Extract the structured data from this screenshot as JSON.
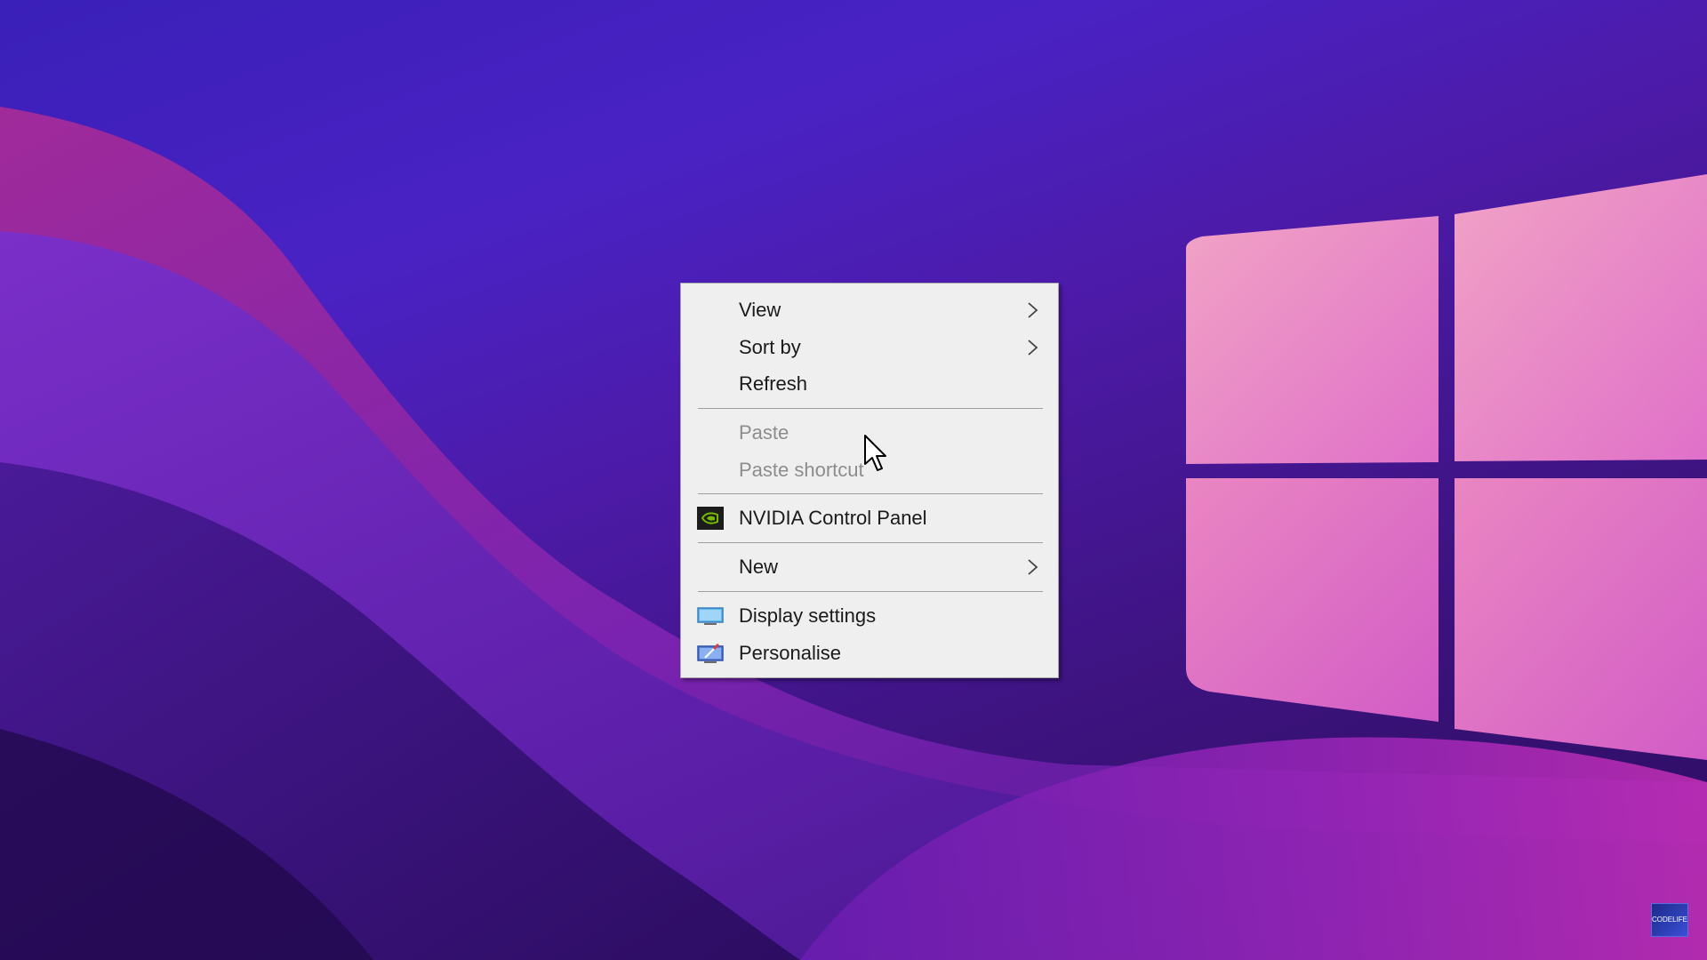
{
  "desktop": {
    "wallpaper": "windows-logo-wave-wallpaper"
  },
  "context_menu": {
    "items": [
      {
        "label": "View",
        "has_submenu": true,
        "disabled": false
      },
      {
        "label": "Sort by",
        "has_submenu": true,
        "disabled": false
      },
      {
        "label": "Refresh",
        "has_submenu": false,
        "disabled": false
      },
      {
        "label": "Paste",
        "has_submenu": false,
        "disabled": true
      },
      {
        "label": "Paste shortcut",
        "has_submenu": false,
        "disabled": true
      },
      {
        "label": "NVIDIA Control Panel",
        "has_submenu": false,
        "disabled": false,
        "icon": "nvidia-icon"
      },
      {
        "label": "New",
        "has_submenu": true,
        "disabled": false
      },
      {
        "label": "Display settings",
        "has_submenu": false,
        "disabled": false,
        "icon": "display-settings-icon"
      },
      {
        "label": "Personalise",
        "has_submenu": false,
        "disabled": false,
        "icon": "personalise-icon"
      }
    ]
  },
  "channel_badge": {
    "text": "CODELIFE"
  },
  "colors": {
    "menu_background": "#efefef",
    "menu_text": "#1a1a1a",
    "menu_disabled_text": "#8d8d8d",
    "nvidia_green": "#76b900"
  }
}
